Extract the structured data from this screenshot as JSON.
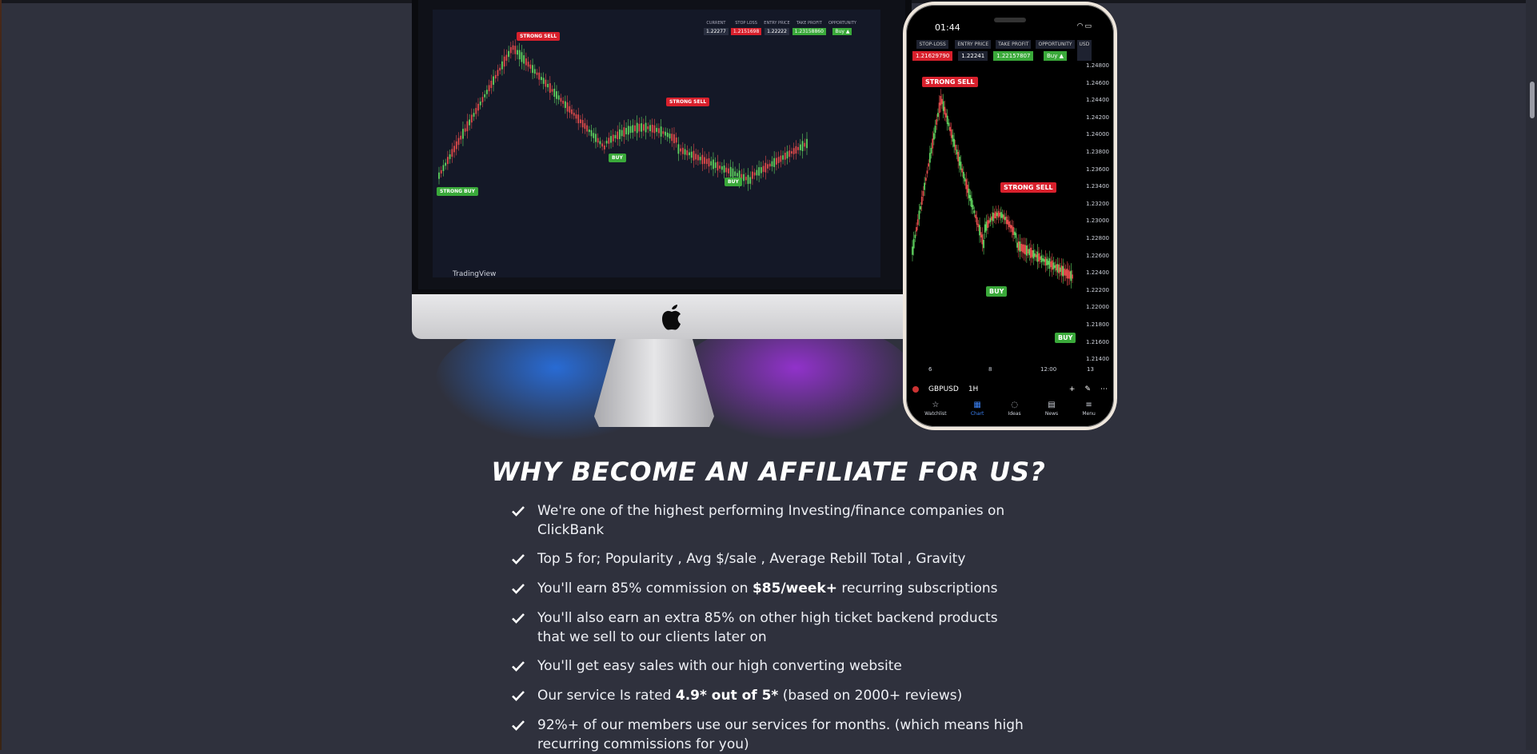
{
  "colors": {
    "background": "#2f313d",
    "sell": "#d8202c",
    "buy": "#3aa93a",
    "phone_frame": "#efe7dd",
    "accent": "#3b82f6"
  },
  "monitor": {
    "brand_mark": "TradingView",
    "price_headers": [
      "CURRENT",
      "STOP LOSS",
      "ENTRY PRICE",
      "TAKE PROFIT",
      "OPPORTUNITY"
    ],
    "price_values": [
      "1.22277",
      "1.2151698",
      "1.22222",
      "1.23158860",
      "Buy ▲"
    ],
    "tags": [
      {
        "label": "STRONG SELL",
        "type": "sell"
      },
      {
        "label": "STRONG SELL",
        "type": "sell"
      },
      {
        "label": "STRONG BUY",
        "type": "buy"
      },
      {
        "label": "BUY",
        "type": "buy"
      },
      {
        "label": "BUY",
        "type": "buy"
      }
    ]
  },
  "phone": {
    "time": "01:44",
    "headers": [
      "STOP-LOSS",
      "ENTRY PRICE",
      "TAKE PROFIT",
      "OPPORTUNITY"
    ],
    "values": [
      "1.21629790",
      "1.22241",
      "1.22157807",
      "Buy ▲"
    ],
    "currency": "USD",
    "tags": [
      {
        "label": "STRONG SELL",
        "type": "sell"
      },
      {
        "label": "STRONG SELL",
        "type": "sell"
      },
      {
        "label": "BUY",
        "type": "buy"
      },
      {
        "label": "BUY",
        "type": "buy"
      }
    ],
    "axis_ticks": [
      "1.24800",
      "1.24600",
      "1.24400",
      "1.24200",
      "1.24000",
      "1.23800",
      "1.23600",
      "1.23400",
      "1.23200",
      "1.23000",
      "1.22800",
      "1.22600",
      "1.22400",
      "1.22200",
      "1.22000",
      "1.21800",
      "1.21600",
      "1.21400"
    ],
    "x_ticks": [
      "6",
      "8",
      "12:00",
      "13"
    ],
    "symbol": "GBPUSD",
    "interval": "1H",
    "nav": [
      {
        "label": "Watchlist",
        "icon": "star-icon"
      },
      {
        "label": "Chart",
        "icon": "chart-icon"
      },
      {
        "label": "Ideas",
        "icon": "bulb-icon"
      },
      {
        "label": "News",
        "icon": "news-icon"
      },
      {
        "label": "Menu",
        "icon": "menu-icon"
      }
    ]
  },
  "section": {
    "title": "WHY BECOME AN AFFILIATE FOR US?",
    "benefits": [
      {
        "text": "We're one of the highest performing Investing/finance companies on ClickBank"
      },
      {
        "text": "Top 5 for; Popularity , Avg $/sale , Average Rebill Total , Gravity"
      },
      {
        "before": "You'll earn 85% commission on ",
        "bold": "$85/week+",
        "after": " recurring subscriptions"
      },
      {
        "text": "You'll also earn an extra 85% on other high ticket backend products that we sell to our clients later on"
      },
      {
        "text": "You'll get easy sales with our high converting website"
      },
      {
        "before": "Our service Is rated ",
        "bold": "4.9* out of 5*",
        "after": " (based on 2000+ reviews)"
      },
      {
        "text": "92%+ of our members use our services for months. (which means high recurring commissions for you)"
      }
    ]
  }
}
